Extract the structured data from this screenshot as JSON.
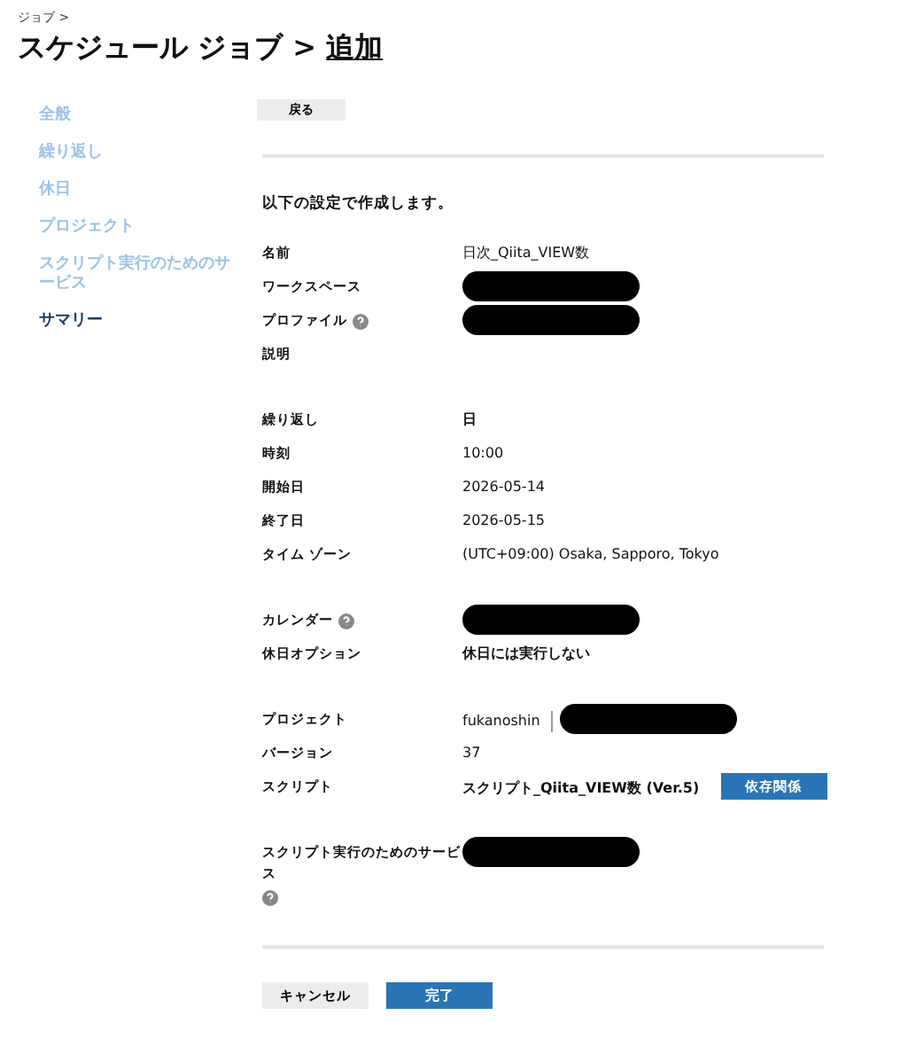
{
  "breadcrumb": "ジョブ >",
  "title": {
    "text": "スケジュール ジョブ > ",
    "link": "追加"
  },
  "sidebar": {
    "items": [
      {
        "label": "全般",
        "selected": false
      },
      {
        "label": "繰り返し",
        "selected": false
      },
      {
        "label": "休日",
        "selected": false
      },
      {
        "label": "プロジェクト",
        "selected": false
      },
      {
        "label": "スクリプト実行のためのサービス",
        "selected": false
      },
      {
        "label": "サマリー",
        "selected": true
      }
    ]
  },
  "back_button": "戻る",
  "intro": "以下の設定で作成します。",
  "groups": [
    [
      {
        "label": "名前",
        "help": false,
        "values": [
          {
            "kind": "text",
            "text": "日次_Qiita_VIEW数"
          }
        ]
      },
      {
        "label": "ワークスペース",
        "help": false,
        "values": [
          {
            "kind": "redacted"
          }
        ]
      },
      {
        "label": "プロファイル",
        "help": true,
        "values": [
          {
            "kind": "redacted"
          }
        ]
      },
      {
        "label": "説明",
        "help": false
      }
    ],
    [
      {
        "label": "繰り返し",
        "help": false,
        "values": [
          {
            "kind": "strong",
            "text": "日"
          }
        ]
      },
      {
        "label": "時刻",
        "help": false,
        "values": [
          {
            "kind": "text",
            "text": "10:00"
          }
        ]
      },
      {
        "label": "開始日",
        "help": false,
        "values": [
          {
            "kind": "text",
            "text": "2026-05-14"
          }
        ]
      },
      {
        "label": "終了日",
        "help": false,
        "values": [
          {
            "kind": "text",
            "text": "2026-05-15"
          }
        ]
      },
      {
        "label": "タイム ゾーン",
        "help": false,
        "values": [
          {
            "kind": "text",
            "text": "(UTC+09:00) Osaka, Sapporo, Tokyo"
          }
        ]
      }
    ],
    [
      {
        "label": "カレンダー",
        "help": true,
        "values": [
          {
            "kind": "redacted"
          }
        ]
      },
      {
        "label": "休日オプション",
        "help": false,
        "values": [
          {
            "kind": "strong",
            "text": "休日には実行しない"
          }
        ]
      }
    ],
    [
      {
        "label": "プロジェクト",
        "help": false,
        "values": [
          {
            "kind": "text",
            "text": "fukanoshin"
          },
          {
            "kind": "redacted"
          }
        ]
      },
      {
        "label": "バージョン",
        "help": false,
        "values": [
          {
            "kind": "text",
            "text": "37"
          }
        ]
      },
      {
        "label": "スクリプト",
        "help": false,
        "values": [
          {
            "kind": "strong",
            "text": "スクリプト_Qiita_VIEW数 (Ver.5)"
          },
          {
            "kind": "button",
            "text": "依存関係"
          }
        ]
      }
    ],
    [
      {
        "label": "スクリプト実行のためのサービス",
        "help": true,
        "values": [
          {
            "kind": "redacted"
          }
        ]
      }
    ]
  ],
  "footer": {
    "cancel": "キャンセル",
    "finish": "完了"
  }
}
